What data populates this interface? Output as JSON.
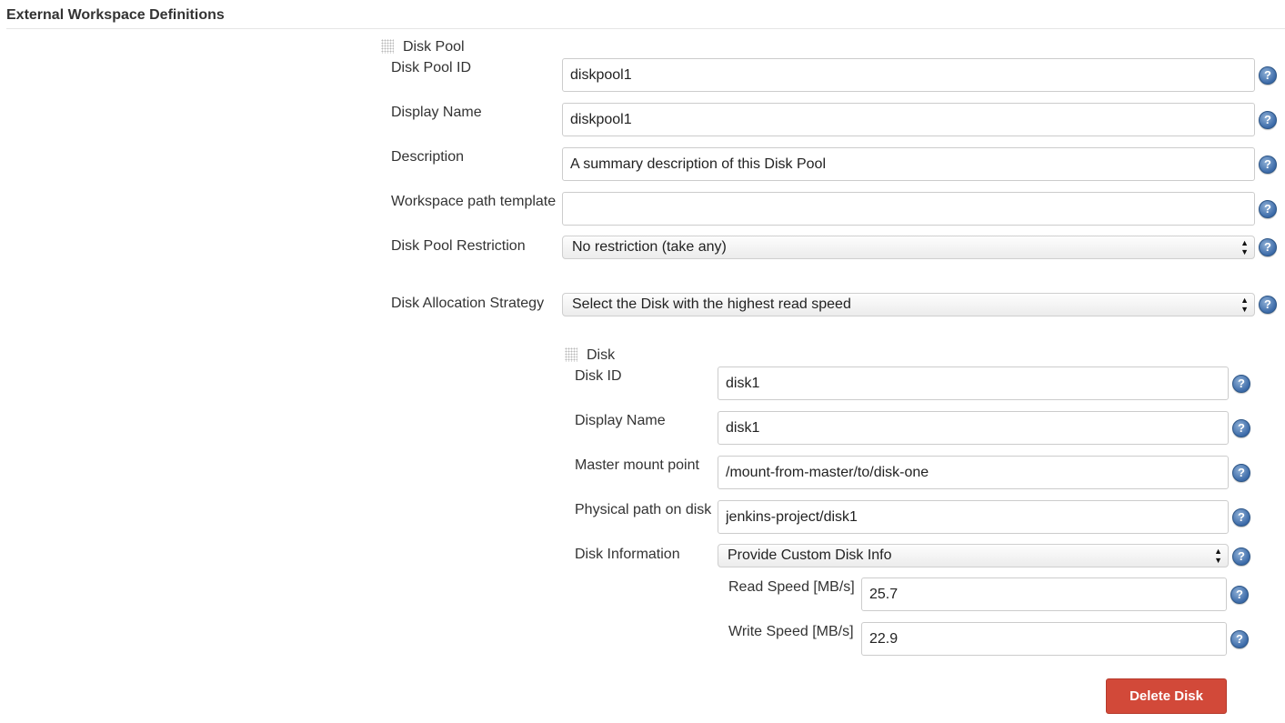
{
  "section": {
    "title": "External Workspace Definitions"
  },
  "disk_pool": {
    "title": "Disk Pool",
    "fields": {
      "disk_pool_id": {
        "label": "Disk Pool ID",
        "value": "diskpool1"
      },
      "display_name": {
        "label": "Display Name",
        "value": "diskpool1"
      },
      "description": {
        "label": "Description",
        "value": "A summary description of this Disk Pool"
      },
      "workspace_path_template": {
        "label": "Workspace path template",
        "value": ""
      },
      "restriction": {
        "label": "Disk Pool Restriction",
        "selected": "No restriction (take any)"
      },
      "allocation_strategy": {
        "label": "Disk Allocation Strategy",
        "selected": "Select the Disk with the highest read speed"
      }
    }
  },
  "disk": {
    "title": "Disk",
    "fields": {
      "disk_id": {
        "label": "Disk ID",
        "value": "disk1"
      },
      "display_name": {
        "label": "Display Name",
        "value": "disk1"
      },
      "master_mount_point": {
        "label": "Master mount point",
        "value": "/mount-from-master/to/disk-one"
      },
      "physical_path": {
        "label": "Physical path on disk",
        "value": "jenkins-project/disk1"
      },
      "disk_information": {
        "label": "Disk Information",
        "selected": "Provide Custom Disk Info"
      },
      "read_speed": {
        "label": "Read Speed [MB/s]",
        "value": "25.7"
      },
      "write_speed": {
        "label": "Write Speed [MB/s]",
        "value": "22.9"
      }
    },
    "delete_label": "Delete Disk"
  },
  "help_glyph": "?",
  "select_arrows": "▲▼",
  "colors": {
    "delete_button": "#d24939",
    "help_icon": "#3b6aa8"
  }
}
